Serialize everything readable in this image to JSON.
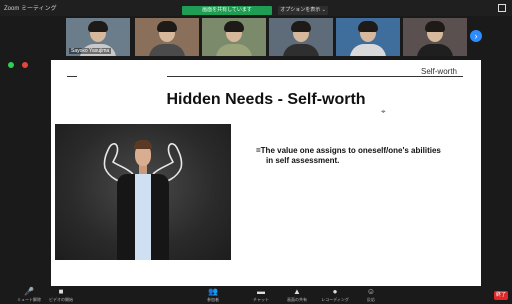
{
  "app": {
    "title": "Zoom ミーティング",
    "share_banner": "画面を共有しています",
    "options_label": "オプションを表示 ⌄"
  },
  "gallery": {
    "tiles": [
      {
        "name": "Sayoko Yasujima",
        "bg": "#6b7d8a",
        "shirt": "#c9c9c9"
      },
      {
        "name": "",
        "bg": "#8a6f5a",
        "shirt": "#4b4b4b"
      },
      {
        "name": "",
        "bg": "#7a8a6a",
        "shirt": "#9aa37a"
      },
      {
        "name": "",
        "bg": "#5e6b78",
        "shirt": "#2f2f2f"
      },
      {
        "name": "",
        "bg": "#3f6d9c",
        "shirt": "#d9d9d9"
      },
      {
        "name": "",
        "bg": "#5a5050",
        "shirt": "#1f1f1f"
      }
    ],
    "next_icon": "chevron-right-icon"
  },
  "slide": {
    "tag": "Self-worth",
    "title": "Hidden Needs - Self-worth",
    "definition_line1": "=The value one assigns to oneself/one's abilities",
    "definition_line2": "in  self assessment."
  },
  "toolbar": {
    "items": [
      {
        "icon": "microphone-icon",
        "glyph": "🎤",
        "label": "ミュート解除"
      },
      {
        "icon": "video-camera-icon",
        "glyph": "■",
        "label": "ビデオの開始"
      },
      {
        "icon": "participants-icon",
        "glyph": "👥",
        "label": "参加者"
      },
      {
        "icon": "chat-icon",
        "glyph": "▬",
        "label": "チャット"
      },
      {
        "icon": "share-screen-icon",
        "glyph": "▲",
        "label": "画面の共有"
      },
      {
        "icon": "record-icon",
        "glyph": "●",
        "label": "レコーディング"
      },
      {
        "icon": "reactions-icon",
        "glyph": "☺",
        "label": "反応"
      }
    ],
    "end_label": "終了"
  }
}
